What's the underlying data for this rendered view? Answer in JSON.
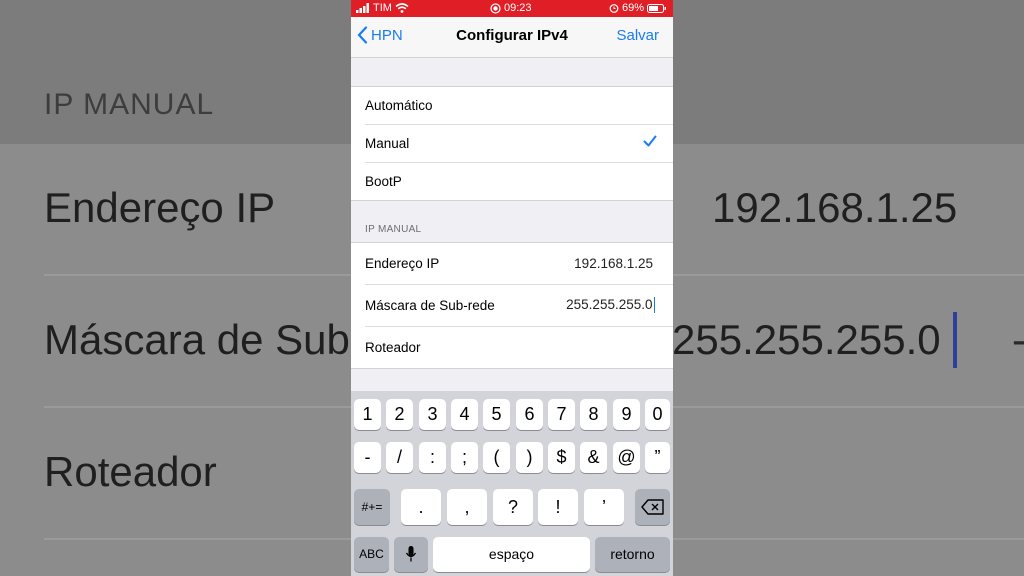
{
  "background": {
    "section_header": "IP MANUAL",
    "row_ip_label": "Endereço IP",
    "row_ip_value": "192.168.1.25",
    "row_mask_label": "Máscara de Sub",
    "row_mask_value": "255.255.255.0",
    "row_router_label": "Roteador"
  },
  "status": {
    "carrier": "TIM",
    "time": "09:23",
    "battery": "69%"
  },
  "nav": {
    "back_label": "HPN",
    "title": "Configurar IPv4",
    "save_label": "Salvar"
  },
  "options": [
    {
      "label": "Automático"
    },
    {
      "label": "Manual"
    },
    {
      "label": "BootP"
    }
  ],
  "manual_section": {
    "header": "IP MANUAL",
    "ip_label": "Endereço IP",
    "ip_value": "192.168.1.25",
    "mask_label": "Máscara de Sub-rede",
    "mask_value": "255.255.255.0",
    "router_label": "Roteador"
  },
  "keyboard": {
    "row1": [
      "1",
      "2",
      "3",
      "4",
      "5",
      "6",
      "7",
      "8",
      "9",
      "0"
    ],
    "row2": [
      "-",
      "/",
      ":",
      ";",
      "(",
      ")",
      "$",
      "&",
      "@",
      "”"
    ],
    "row3": [
      ".",
      ",",
      "?",
      "!",
      "’"
    ],
    "symbols_key": "#+=",
    "abc_key": "ABC",
    "space_key": "espaço",
    "return_key": "retorno"
  },
  "colors": {
    "accent": "#1a7cf5",
    "status_bar": "#e01e26"
  }
}
